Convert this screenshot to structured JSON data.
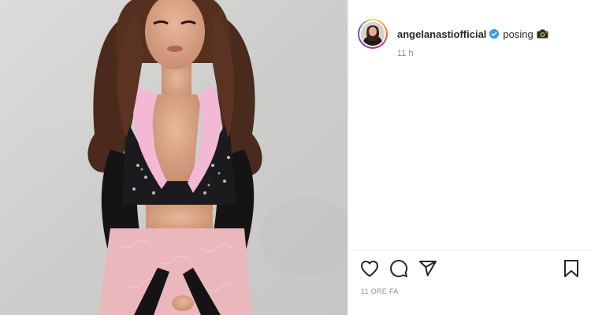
{
  "post": {
    "username": "angelanastiofficial",
    "verified": true,
    "caption": "posing",
    "caption_emoji": "camera-icon",
    "time_ago": "11 h",
    "date_label": "11 ORE FA"
  },
  "icons": {
    "like": "heart-icon",
    "comment": "comment-icon",
    "share": "share-icon",
    "save": "bookmark-icon"
  },
  "colors": {
    "verified_badge": "#3897f0",
    "text_primary": "#262626",
    "text_secondary": "#8e8e8e"
  }
}
